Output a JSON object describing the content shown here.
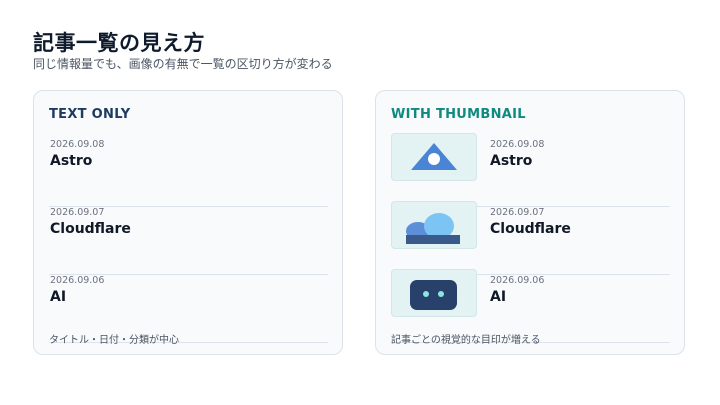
{
  "title": "記事一覧の見え方",
  "subtitle": "同じ情報量でも、画像の有無で一覧の区切り方が変わる",
  "left_card": {
    "heading": "TEXT ONLY",
    "items": [
      {
        "date": "2026.09.08",
        "name": "Astro"
      },
      {
        "date": "2026.09.07",
        "name": "Cloudflare"
      },
      {
        "date": "2026.09.06",
        "name": "AI"
      }
    ],
    "footer": "タイトル・日付・分類が中心"
  },
  "right_card": {
    "heading": "WITH THUMBNAIL",
    "items": [
      {
        "date": "2026.09.08",
        "name": "Astro",
        "thumb_icon": "mountain-icon"
      },
      {
        "date": "2026.09.07",
        "name": "Cloudflare",
        "thumb_icon": "cloud-icon"
      },
      {
        "date": "2026.09.06",
        "name": "AI",
        "thumb_icon": "robot-face-icon"
      }
    ],
    "footer": "記事ごとの視覚的な目印が増える"
  },
  "colors": {
    "title": "#0f1b2d",
    "left_heading": "#1e3a5f",
    "right_heading": "#0f8a7e",
    "card_bg": "#f8fafc",
    "card_border": "#dbe2ea",
    "thumb_bg": "#e3f2f3",
    "astro_blue": "#4a84d4",
    "cloud_blue": "#64b5f6",
    "robot_navy": "#28416b",
    "robot_eye": "#8fe3e0"
  }
}
